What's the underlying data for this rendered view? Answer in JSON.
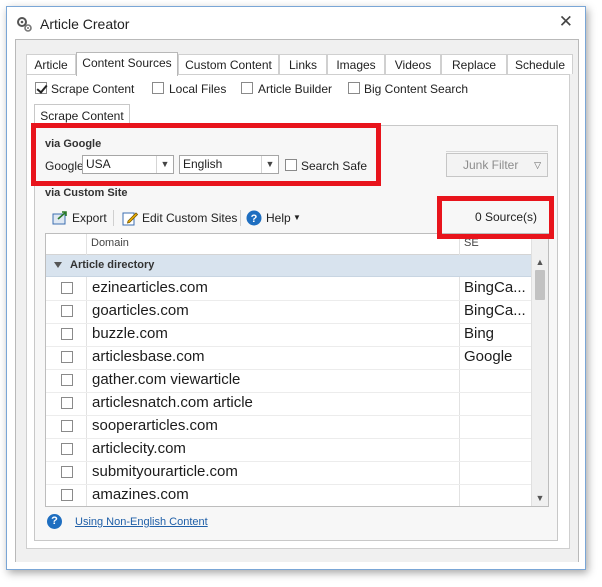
{
  "window": {
    "title": "Article Creator",
    "close": "✕"
  },
  "tabs": [
    {
      "label": "Article"
    },
    {
      "label": "Content Sources"
    },
    {
      "label": "Custom Content"
    },
    {
      "label": "Links"
    },
    {
      "label": "Images"
    },
    {
      "label": "Videos"
    },
    {
      "label": "Replace"
    },
    {
      "label": "Schedule"
    }
  ],
  "sources": {
    "options": [
      {
        "label": "Scrape Content",
        "checked": true
      },
      {
        "label": "Local Files",
        "checked": false
      },
      {
        "label": "Article Builder",
        "checked": false
      },
      {
        "label": "Big Content Search",
        "checked": false
      }
    ],
    "subtab": "Scrape Content"
  },
  "google": {
    "section": "via Google",
    "label": "Google",
    "country": "USA",
    "language": "English",
    "search_safe": "Search Safe",
    "search_safe_checked": false
  },
  "junk_filter": "Junk Filter",
  "custom_site": {
    "section": "via Custom Site",
    "export": "Export",
    "edit": "Edit Custom Sites",
    "help": "Help",
    "count": "0 Source(s)"
  },
  "grid": {
    "col_domain": "Domain",
    "col_se": "SE",
    "group": "Article directory",
    "rows": [
      {
        "domain": "ezinearticles.com",
        "se": "BingCa..."
      },
      {
        "domain": "goarticles.com",
        "se": "BingCa..."
      },
      {
        "domain": "buzzle.com",
        "se": "Bing"
      },
      {
        "domain": "articlesbase.com",
        "se": "Google"
      },
      {
        "domain": "gather.com viewarticle",
        "se": ""
      },
      {
        "domain": "articlesnatch.com article",
        "se": ""
      },
      {
        "domain": "sooperarticles.com",
        "se": ""
      },
      {
        "domain": "articlecity.com",
        "se": ""
      },
      {
        "domain": "submityourarticle.com",
        "se": ""
      },
      {
        "domain": "amazines.com",
        "se": ""
      }
    ]
  },
  "footer_link": "Using Non-English Content",
  "colors": {
    "highlight": "#e8141c",
    "link": "#1f5fa8",
    "group_bg": "#d8e3ee"
  }
}
